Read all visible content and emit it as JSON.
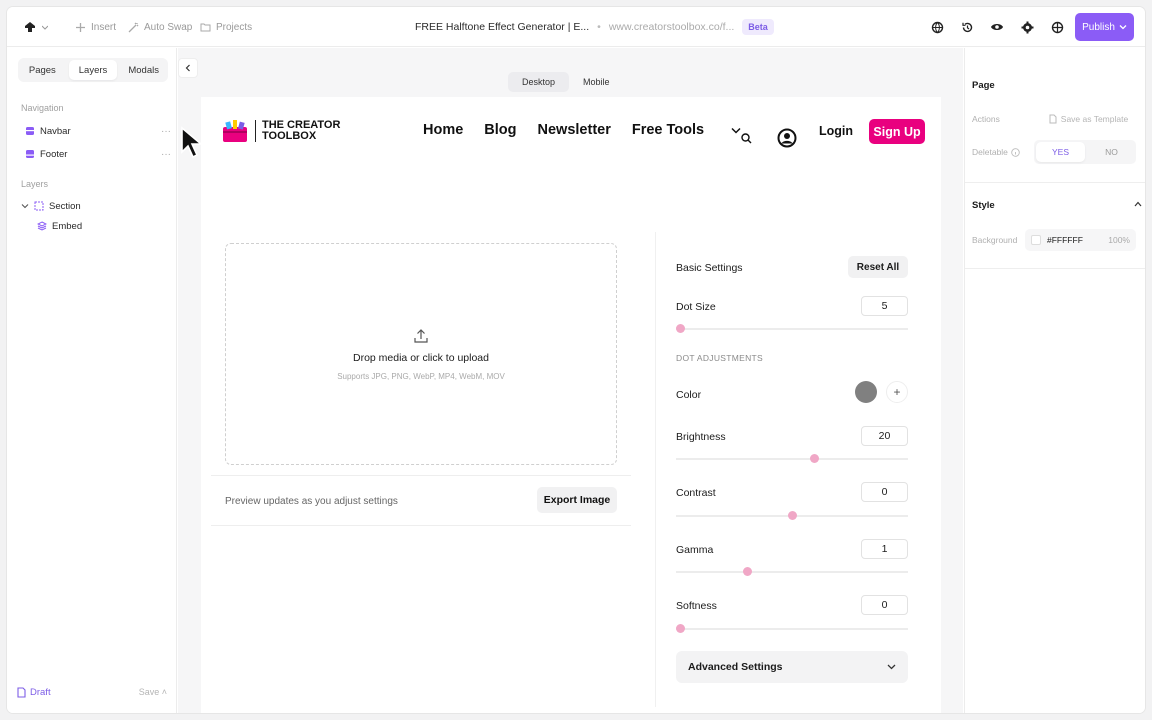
{
  "topbar": {
    "insert": "Insert",
    "auto_swap": "Auto Swap",
    "projects": "Projects",
    "doc_title": "FREE Halftone Effect Generator | E...",
    "separator": "•",
    "doc_url": "www.creatorstoolbox.co/f...",
    "beta": "Beta",
    "publish": "Publish"
  },
  "left_panel": {
    "tabs": [
      "Pages",
      "Layers",
      "Modals"
    ],
    "active_tab": "Layers",
    "navigation_heading": "Navigation",
    "navigation_items": [
      "Navbar",
      "Footer"
    ],
    "layers_heading": "Layers",
    "layers": [
      {
        "label": "Section"
      },
      {
        "label": "Embed"
      }
    ],
    "draft": "Draft",
    "save": "Save"
  },
  "canvas": {
    "device_tabs": [
      "Desktop",
      "Mobile"
    ],
    "active_device": "Desktop"
  },
  "site": {
    "logo_line1": "THE CREATOR",
    "logo_line2": "TOOLBOX",
    "nav": [
      "Home",
      "Blog",
      "Newsletter",
      "Free Tools"
    ],
    "login": "Login",
    "signup": "Sign Up",
    "upload_title": "Drop media or click to upload",
    "upload_sub": "Supports JPG, PNG, WebP, MP4, WebM, MOV",
    "preview_text": "Preview updates as you adjust settings",
    "export": "Export Image",
    "accent": "#e9007f"
  },
  "settings": {
    "basic": "Basic Settings",
    "reset": "Reset All",
    "dot_size_label": "Dot Size",
    "dot_size": "5",
    "dot_size_level": 0.0,
    "dot_adjustments": "DOT ADJUSTMENTS",
    "color_label": "Color",
    "color_value": "#808080",
    "brightness_label": "Brightness",
    "brightness": "20",
    "brightness_level": 0.6,
    "contrast_label": "Contrast",
    "contrast": "0",
    "contrast_level": 0.5,
    "gamma_label": "Gamma",
    "gamma": "1",
    "gamma_level": 0.3,
    "softness_label": "Softness",
    "softness": "0",
    "softness_level": 0.0,
    "advanced": "Advanced Settings"
  },
  "right_panel": {
    "page_heading": "Page",
    "actions_label": "Actions",
    "save_template": "Save as Template",
    "deletable_label": "Deletable",
    "yes": "YES",
    "no": "NO",
    "style_heading": "Style",
    "background_label": "Background",
    "bg_hex": "#FFFFFF",
    "bg_opacity": "100%"
  }
}
